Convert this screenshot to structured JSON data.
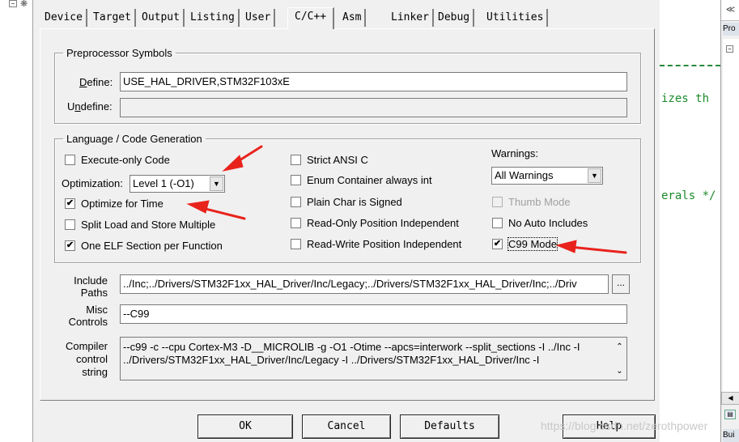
{
  "tabs": [
    "Device",
    "Target",
    "Output",
    "Listing",
    "User",
    "C/C++",
    "Asm",
    "Linker",
    "Debug",
    "Utilities"
  ],
  "active_tab": "C/C++",
  "preprocessor": {
    "legend": "Preprocessor Symbols",
    "define_label": "Define:",
    "define_value": "USE_HAL_DRIVER,STM32F103xE",
    "undefine_label": "Undefine:",
    "undefine_value": ""
  },
  "language": {
    "legend": "Language / Code Generation",
    "execute_only": "Execute-only Code",
    "optimization_label": "Optimization:",
    "optimization_value": "Level 1 (-O1)",
    "optimize_time": "Optimize for Time",
    "split_load": "Split Load and Store Multiple",
    "one_elf": "One ELF Section per Function",
    "strict_ansi": "Strict ANSI C",
    "enum_container": "Enum Container always int",
    "plain_char": "Plain Char is Signed",
    "ro_pi": "Read-Only Position Independent",
    "rw_pi": "Read-Write Position Independent",
    "warnings_label": "Warnings:",
    "warnings_value": "All Warnings",
    "thumb_mode": "Thumb Mode",
    "no_auto_includes": "No Auto Includes",
    "c99_mode": "C99 Mode",
    "check_mark": "✔"
  },
  "include": {
    "label_line1": "Include",
    "label_line2": "Paths",
    "value": "../Inc;../Drivers/STM32F1xx_HAL_Driver/Inc/Legacy;../Drivers/STM32F1xx_HAL_Driver/Inc;../Driv",
    "browse": "..."
  },
  "misc": {
    "label_line1": "Misc",
    "label_line2": "Controls",
    "value": "--C99"
  },
  "compiler": {
    "label_line1": "Compiler",
    "label_line2": "control",
    "label_line3": "string",
    "line1": "--c99 -c --cpu Cortex-M3 -D__MICROLIB -g -O1 -Otime --apcs=interwork --split_sections -I ../Inc -I",
    "line2": "../Drivers/STM32F1xx_HAL_Driver/Inc/Legacy -I ../Drivers/STM32F1xx_HAL_Driver/Inc -I"
  },
  "buttons": {
    "ok": "OK",
    "cancel": "Cancel",
    "defaults": "Defaults",
    "help": "Help"
  },
  "watermark": "https://blog.csdn.net/zerothpower",
  "background": {
    "code_line1": "izes th",
    "code_line2": "erals */",
    "side_top": "≪",
    "side_pro": "Pro",
    "side_bui": "Bui"
  },
  "colors": {
    "arrow_red": "#e8231c",
    "code_green": "#1a8a2a"
  }
}
